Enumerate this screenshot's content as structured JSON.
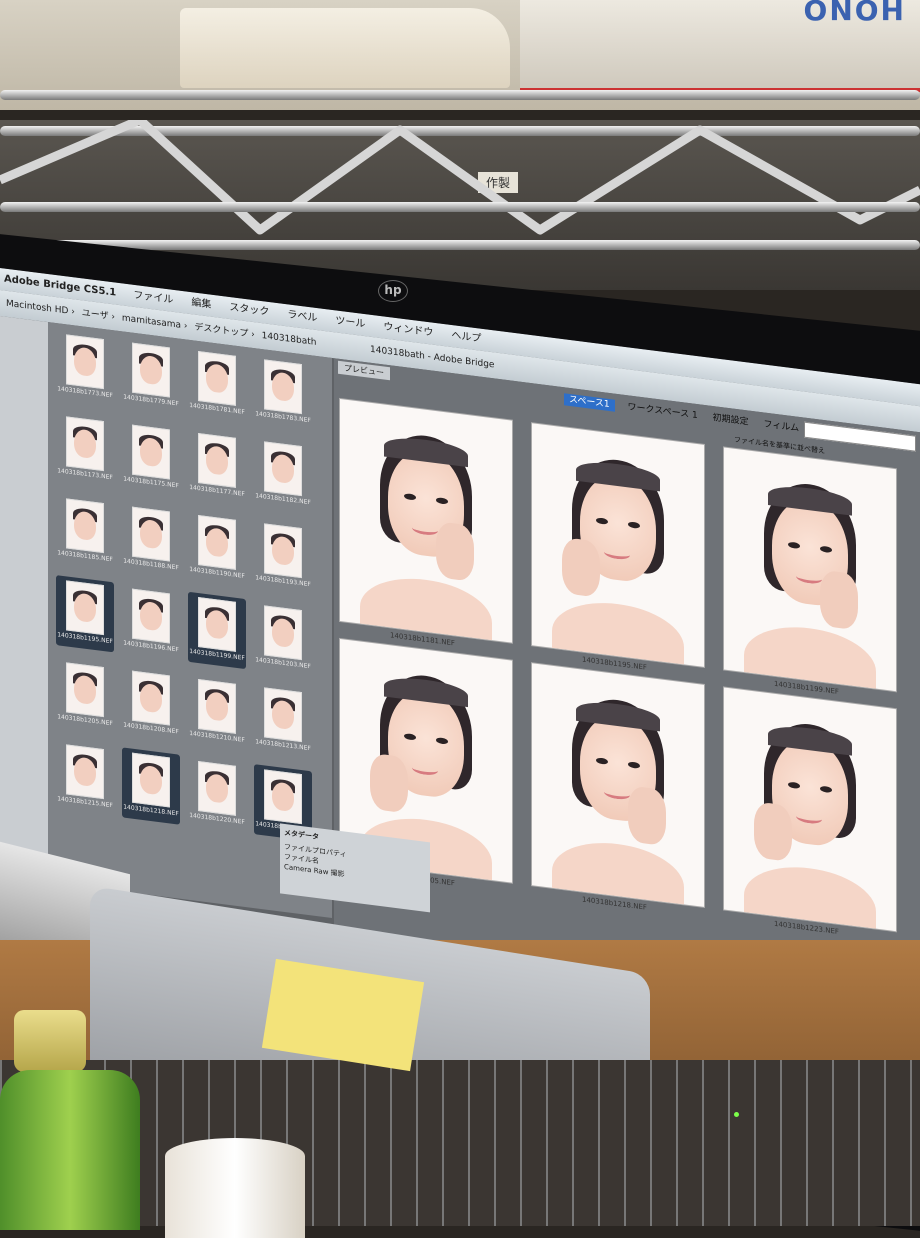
{
  "environment": {
    "box_brand": "ONOH",
    "shelf_sticker": "作製",
    "monitor_brand": "hp"
  },
  "app": {
    "title": "Adobe Bridge CS5.1",
    "menu": [
      "ファイル",
      "編集",
      "スタック",
      "ラベル",
      "ツール",
      "ウィンドウ",
      "ヘルプ"
    ],
    "path": [
      "Macintosh HD",
      "ユーザ",
      "mamitasama",
      "デスクトップ",
      "140318bath"
    ],
    "window_title": "140318bath - Adobe Bridge",
    "preview_tab": "プレビュー",
    "workspace": {
      "active": "スペース1",
      "items": [
        "ワークスペース 1",
        "初期設定",
        "フィルム"
      ]
    },
    "search_placeholder": "",
    "sort_label": "ファイル名を基準に並べ替え"
  },
  "thumbnails": [
    {
      "caption": "140318b1773.NEF",
      "selected": false
    },
    {
      "caption": "140318b1779.NEF",
      "selected": false
    },
    {
      "caption": "140318b1781.NEF",
      "selected": false
    },
    {
      "caption": "140318b1783.NEF",
      "selected": false
    },
    {
      "caption": "140318b1173.NEF",
      "selected": false
    },
    {
      "caption": "140318b1175.NEF",
      "selected": false
    },
    {
      "caption": "140318b1177.NEF",
      "selected": false
    },
    {
      "caption": "140318b1182.NEF",
      "selected": false
    },
    {
      "caption": "140318b1185.NEF",
      "selected": false
    },
    {
      "caption": "140318b1188.NEF",
      "selected": false
    },
    {
      "caption": "140318b1190.NEF",
      "selected": false
    },
    {
      "caption": "140318b1193.NEF",
      "selected": false
    },
    {
      "caption": "140318b1195.NEF",
      "selected": true
    },
    {
      "caption": "140318b1196.NEF",
      "selected": false
    },
    {
      "caption": "140318b1199.NEF",
      "selected": true
    },
    {
      "caption": "140318b1203.NEF",
      "selected": false
    },
    {
      "caption": "140318b1205.NEF",
      "selected": false
    },
    {
      "caption": "140318b1208.NEF",
      "selected": false
    },
    {
      "caption": "140318b1210.NEF",
      "selected": false
    },
    {
      "caption": "140318b1213.NEF",
      "selected": false
    },
    {
      "caption": "140318b1215.NEF",
      "selected": false
    },
    {
      "caption": "140318b1218.NEF",
      "selected": true
    },
    {
      "caption": "140318b1220.NEF",
      "selected": false
    },
    {
      "caption": "140318b1223.NEF",
      "selected": true
    }
  ],
  "previews": [
    {
      "caption": "140318b1181.NEF"
    },
    {
      "caption": "140318b1195.NEF"
    },
    {
      "caption": "140318b1199.NEF"
    },
    {
      "caption": "140318b1205.NEF"
    },
    {
      "caption": "140318b1218.NEF"
    },
    {
      "caption": "140318b1223.NEF"
    }
  ],
  "metadata_panel": {
    "tab": "メタデータ",
    "rows": [
      "ファイルプロパティ",
      "ファイル名",
      "Camera Raw 撮影"
    ]
  },
  "colors": {
    "workspace_active": "#2e6fc9",
    "thumb_selected": "#2d3a4a",
    "sticky_note": "#f3e37a",
    "bottle": "#6fae33"
  }
}
